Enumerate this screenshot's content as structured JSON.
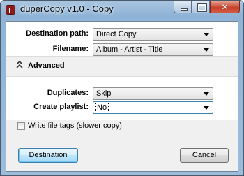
{
  "window": {
    "title": "duperCopy v1.0 - Copy",
    "close_glyph": "✕"
  },
  "paths": {
    "destination_label": "Destination path:",
    "destination_value": "Direct Copy",
    "filename_label": "Filename:",
    "filename_value": "Album - Artist - Title"
  },
  "advanced": {
    "toggle_label": "Advanced",
    "toggle_icon": "double-chevron-up",
    "duplicates_label": "Duplicates:",
    "duplicates_value": "Skip",
    "playlist_label": "Create playlist:",
    "playlist_value": "No",
    "write_tags_label": "Write file tags (slower copy)",
    "write_tags_checked": false
  },
  "buttons": {
    "destination": "Destination",
    "cancel": "Cancel"
  },
  "colors": {
    "accent": "#3c7fb1",
    "close_button": "#c6412a",
    "app_icon": "#8b1b1b"
  }
}
